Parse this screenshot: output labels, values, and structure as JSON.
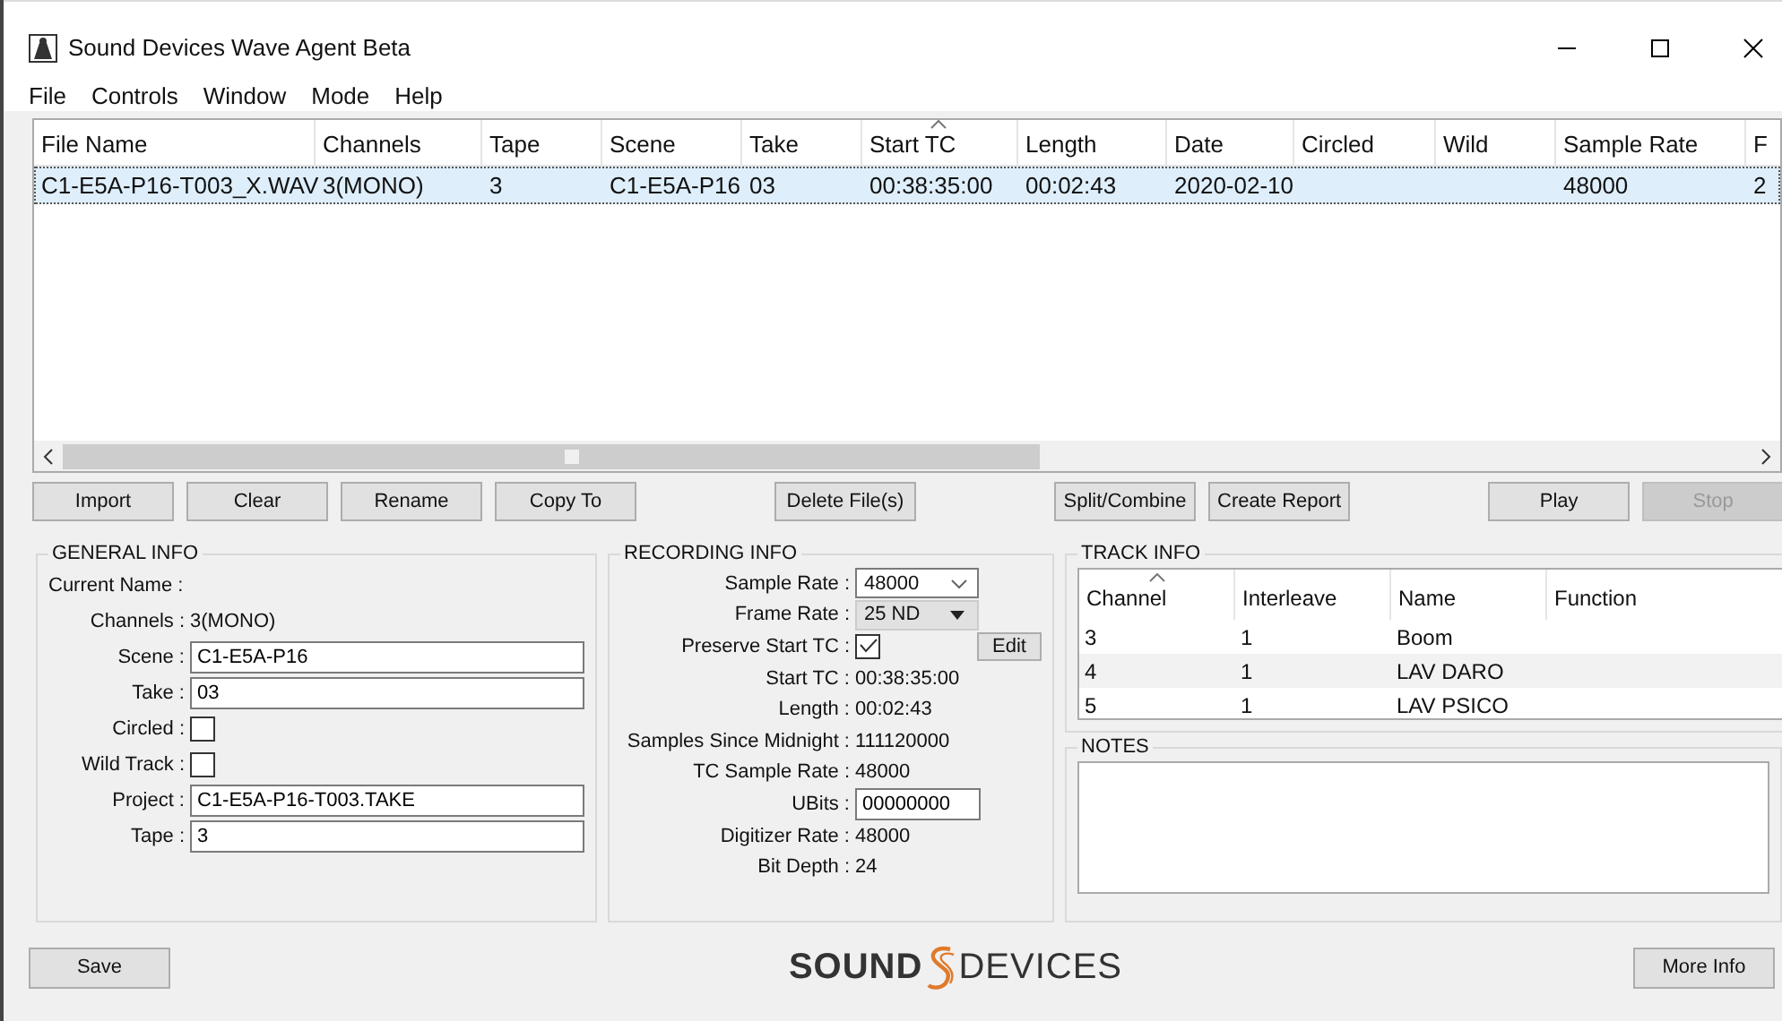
{
  "window": {
    "title": "Sound Devices Wave Agent Beta"
  },
  "menu": [
    "File",
    "Controls",
    "Window",
    "Mode",
    "Help"
  ],
  "table": {
    "columns": [
      {
        "label": "File Name",
        "sorted": false
      },
      {
        "label": "Channels",
        "sorted": false
      },
      {
        "label": "Tape",
        "sorted": false
      },
      {
        "label": "Scene",
        "sorted": false
      },
      {
        "label": "Take",
        "sorted": false
      },
      {
        "label": "Start TC",
        "sorted": true
      },
      {
        "label": "Length",
        "sorted": false
      },
      {
        "label": "Date",
        "sorted": false
      },
      {
        "label": "Circled",
        "sorted": false
      },
      {
        "label": "Wild",
        "sorted": false
      },
      {
        "label": "Sample Rate",
        "sorted": false
      },
      {
        "label": "F"
      }
    ],
    "rows": [
      {
        "selected": true,
        "cells": [
          "C1-E5A-P16-T003_X.WAV",
          "3(MONO)",
          "3",
          "C1-E5A-P16",
          "03",
          "00:38:35:00",
          "00:02:43",
          "2020-02-10",
          "",
          "",
          "48000",
          "2"
        ]
      }
    ]
  },
  "toolbar": [
    [
      {
        "label": "Import",
        "disabled": false
      },
      {
        "label": "Clear",
        "disabled": false
      },
      {
        "label": "Rename",
        "disabled": false
      },
      {
        "label": "Copy To",
        "disabled": false
      }
    ],
    [
      {
        "label": "Delete File(s)",
        "disabled": false
      }
    ],
    [
      {
        "label": "Split/Combine",
        "disabled": false
      },
      {
        "label": "Create Report",
        "disabled": false
      }
    ],
    [
      {
        "label": "Play",
        "disabled": false
      },
      {
        "label": "Stop",
        "disabled": true
      }
    ]
  ],
  "general_info": {
    "title": "GENERAL INFO",
    "fields": [
      {
        "kind": "text",
        "label": "Current Name :"
      },
      {
        "kind": "text",
        "label": "Channels :",
        "value": "3(MONO)"
      },
      {
        "kind": "input",
        "label": "Scene :",
        "value": "C1-E5A-P16"
      },
      {
        "kind": "input",
        "label": "Take :",
        "value": "03"
      },
      {
        "kind": "checkbox",
        "label": "Circled :",
        "checked": false
      },
      {
        "kind": "checkbox",
        "label": "Wild Track :",
        "checked": false
      },
      {
        "kind": "input",
        "label": "Project :",
        "value": "C1-E5A-P16-T003.TAKE"
      },
      {
        "kind": "input",
        "label": "Tape :",
        "value": "3"
      }
    ]
  },
  "recording_info": {
    "title": "RECORDING INFO",
    "fields": [
      {
        "kind": "combo",
        "label": "Sample Rate :",
        "value": "48000"
      },
      {
        "kind": "dropdown",
        "label": "Frame Rate :",
        "value": "25 ND"
      },
      {
        "kind": "checkbox",
        "label": "Preserve Start TC :",
        "checked": true,
        "button": "Edit"
      },
      {
        "kind": "text",
        "label": "Start TC :",
        "value": "00:38:35:00"
      },
      {
        "kind": "text",
        "label": "Length :",
        "value": "00:02:43"
      },
      {
        "kind": "text",
        "label": "Samples Since Midnight :",
        "value": "111120000"
      },
      {
        "kind": "text",
        "label": "TC Sample Rate :",
        "value": "48000"
      },
      {
        "kind": "input",
        "label": "UBits :",
        "value": "00000000"
      },
      {
        "kind": "text",
        "label": "Digitizer Rate :",
        "value": "48000"
      },
      {
        "kind": "text",
        "label": "Bit Depth :",
        "value": "24"
      }
    ]
  },
  "track_info": {
    "title": "TRACK INFO",
    "columns": [
      {
        "label": "Channel",
        "sorted": true
      },
      {
        "label": "Interleave",
        "sorted": false
      },
      {
        "label": "Name",
        "sorted": false
      },
      {
        "label": "Function",
        "sorted": false
      }
    ],
    "rows": [
      [
        "3",
        "1",
        "Boom",
        ""
      ],
      [
        "4",
        "1",
        "LAV DARO",
        ""
      ],
      [
        "5",
        "1",
        "LAV PSICO",
        ""
      ]
    ]
  },
  "notes": {
    "title": "NOTES"
  },
  "footer": {
    "save": "Save",
    "logo_left": "SOUND",
    "logo_right": "DEVICES",
    "more_info": "More Info"
  }
}
